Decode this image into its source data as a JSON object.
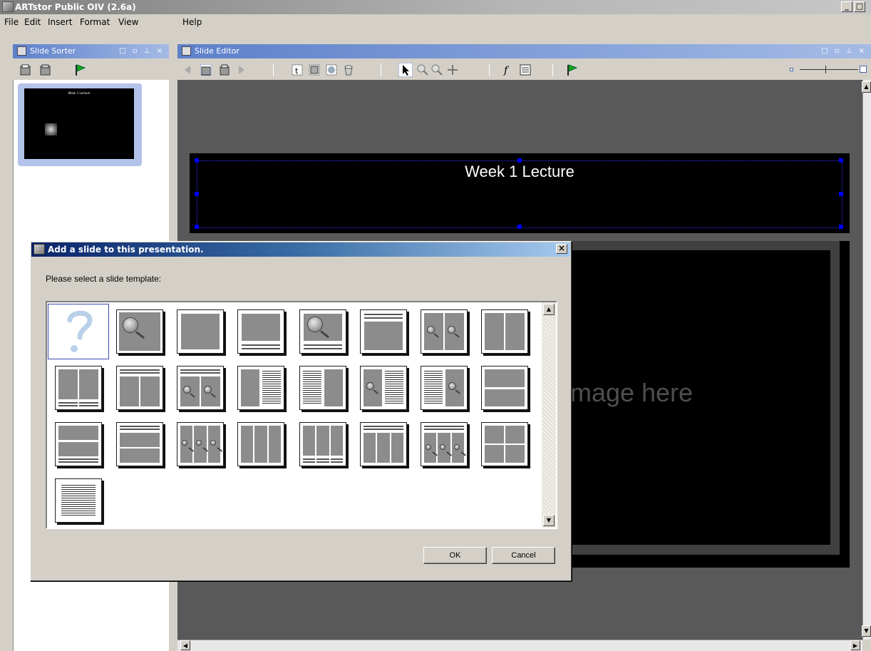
{
  "app": {
    "title": "ARTstor Public OIV (2.6a)"
  },
  "menu": [
    "File",
    "Edit",
    "Insert",
    "Format",
    "View",
    "Help"
  ],
  "panels": {
    "sorter": {
      "title": "Slide Sorter"
    },
    "editor": {
      "title": "Slide Editor"
    }
  },
  "slide": {
    "title": "Week 1 Lecture",
    "placeholder": "Place image here",
    "thumbnail_title": "Week 1 Lecture"
  },
  "dialog": {
    "title": "Add a slide to this presentation.",
    "prompt": "Please select a slide template:",
    "ok_label": "OK",
    "cancel_label": "Cancel"
  },
  "colors": {
    "editor_bg": "#595959",
    "dialog_title": "#0a246a",
    "panel_header": "#5d80ca",
    "selection_handle": "#0000ff"
  }
}
